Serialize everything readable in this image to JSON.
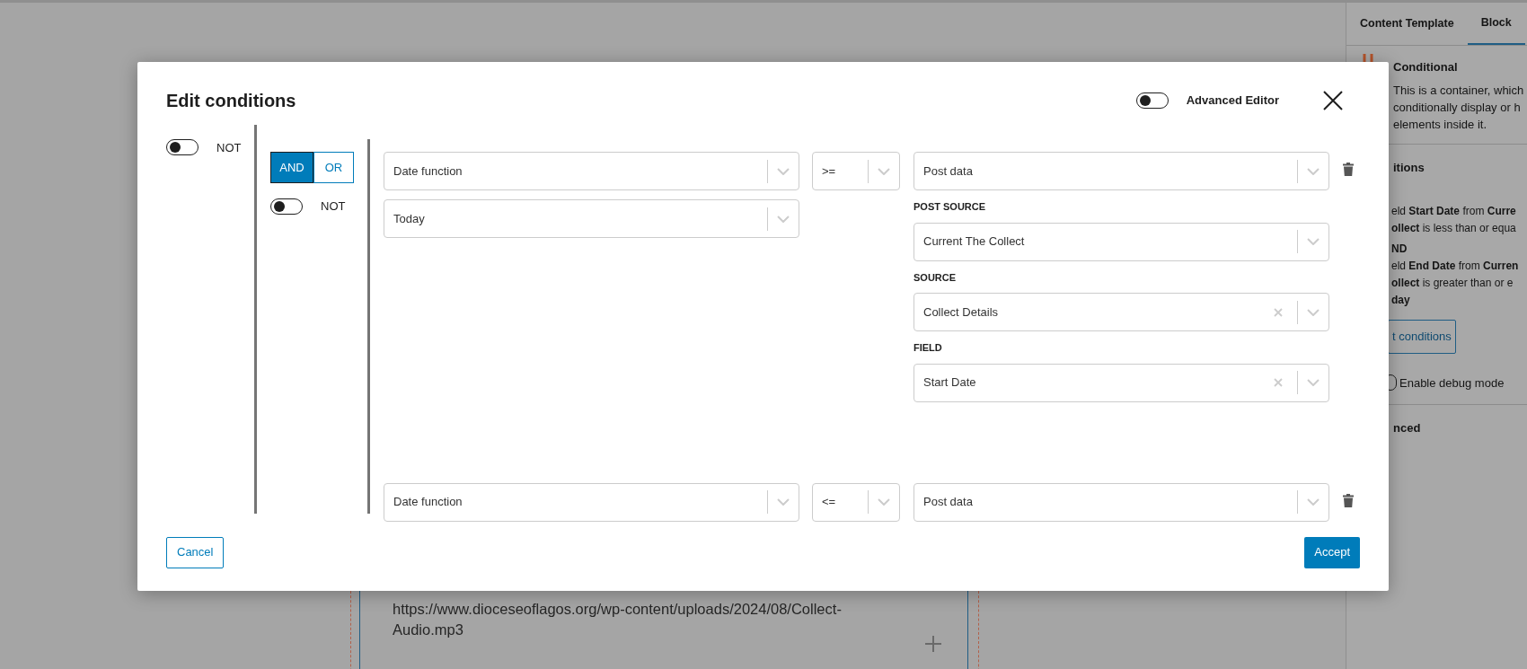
{
  "editor": {
    "url_text": "https://www.dioceseoflagos.org/wp-content/uploads/2024/08/Collect-Audio.mp3"
  },
  "sidebar": {
    "tabs": [
      {
        "label": "Content Template",
        "selected": false
      },
      {
        "label": "Block",
        "selected": true
      }
    ],
    "block_title": "Conditional",
    "block_description": [
      "This is a container, which",
      "conditionally display or h",
      "elements inside it."
    ],
    "section_title": "itions",
    "summary": [
      "eld **Start Date** from **Curre**",
      "**ollect** is less than or equa",
      "**ND**",
      "eld **End Date** from **Curren**",
      "**ollect** is greater than or e",
      "**day**"
    ],
    "edit_button": "t conditions",
    "debug_mode": {
      "label": "Enable debug mode"
    },
    "advanced_section": "nced"
  },
  "modal": {
    "title": "Edit conditions",
    "advanced_editor": {
      "label": "Advanced Editor",
      "on": false
    },
    "not_toggle": {
      "label": "NOT",
      "on": false
    },
    "group": {
      "operators": [
        {
          "label": "AND",
          "selected": true
        },
        {
          "label": "OR",
          "selected": false
        }
      ],
      "not_toggle": {
        "label": "NOT",
        "on": false
      },
      "conditions": [
        {
          "left": [
            {
              "value": "Date function",
              "clearable": false
            },
            {
              "value": "Today",
              "clearable": false
            }
          ],
          "operator": {
            "value": ">=",
            "clearable": false
          },
          "right": {
            "value": "Post data",
            "clearable": false
          },
          "right_fields": [
            {
              "label": "POST SOURCE",
              "value": "Current The Collect",
              "clearable": false
            },
            {
              "label": "SOURCE",
              "value": "Collect Details",
              "clearable": true
            },
            {
              "label": "FIELD",
              "value": "Start Date",
              "clearable": true
            }
          ]
        },
        {
          "left": [
            {
              "value": "Date function",
              "clearable": false
            }
          ],
          "operator": {
            "value": "<=",
            "clearable": false
          },
          "right": {
            "value": "Post data",
            "clearable": false
          }
        }
      ]
    },
    "cancel_button": "Cancel",
    "accept_button": "Accept"
  }
}
